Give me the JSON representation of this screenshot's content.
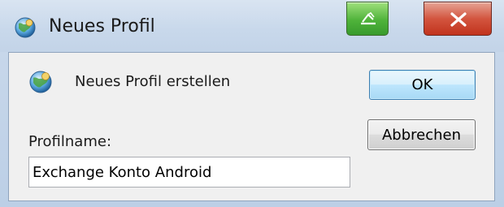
{
  "window": {
    "title": "Neues Profil",
    "icon": "globe-profile-icon",
    "controls": {
      "restore_icon": "restore-icon",
      "close_icon": "close-icon"
    }
  },
  "dialog": {
    "heading": "Neues Profil erstellen",
    "icon": "globe-profile-icon",
    "profile_label": "Profilname:",
    "profile_value": "Exchange Konto Android",
    "ok_label": "OK",
    "cancel_label": "Abbrechen"
  },
  "colors": {
    "restore_green": "#4fb33a",
    "close_red": "#d3553f",
    "ok_focus_blue": "#a7d9f5",
    "dialog_bg": "#f0f0f0"
  }
}
